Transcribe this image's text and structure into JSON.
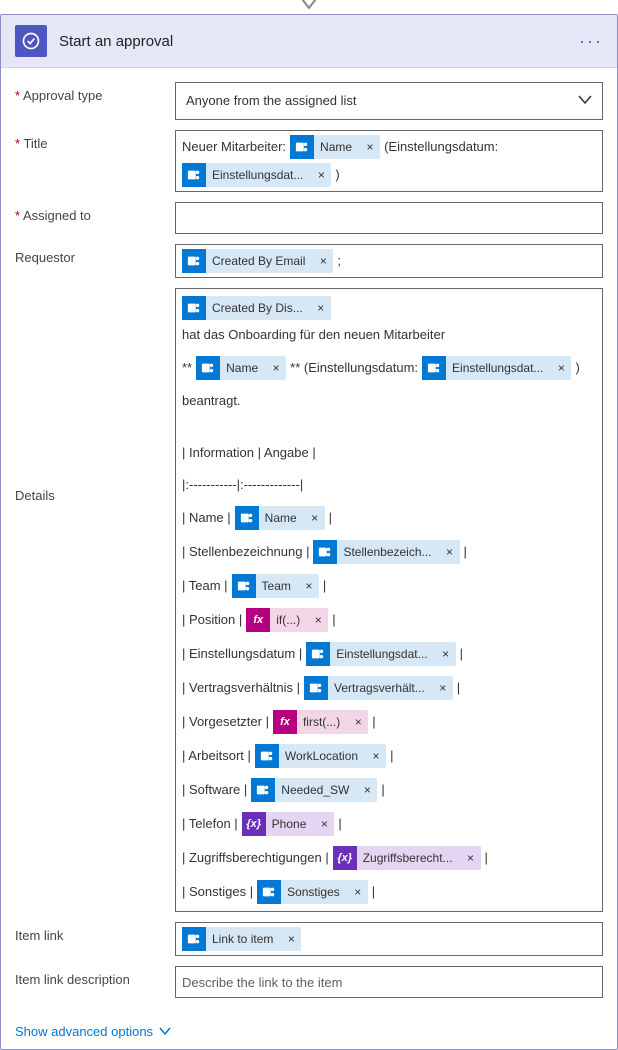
{
  "header": {
    "title": "Start an approval"
  },
  "approval_type": {
    "label": "Approval type",
    "value": "Anyone from the assigned list"
  },
  "title": {
    "label": "Title",
    "text_before": "Neuer Mitarbeiter:",
    "token_name": "Name",
    "text_mid": "(Einstellungsdatum:",
    "token_date": "Einstellungsdat...",
    "text_after": ")"
  },
  "assigned_to": {
    "label": "Assigned to"
  },
  "requestor": {
    "label": "Requestor",
    "token": "Created By Email",
    "after": ";"
  },
  "details": {
    "label": "Details",
    "line1_t1": "Created By Dis...",
    "line1_txt": "hat das Onboarding für den neuen Mitarbeiter",
    "line2_pre": "**",
    "line2_name": "Name",
    "line2_mid": "** (Einstellungsdatum:",
    "line2_date": "Einstellungsdat...",
    "line2_end": ")",
    "line3": "beantragt.",
    "table_header": "| Information | Angabe |",
    "table_sep": "|:-----------|:-------------|",
    "row_name_l": "| Name |",
    "row_name_t": "Name",
    "row_name_e": "|",
    "row_stelle_l": "| Stellenbezeichnung |",
    "row_stelle_t": "Stellenbezeich...",
    "row_stelle_e": "|",
    "row_team_l": "| Team |",
    "row_team_t": "Team",
    "row_team_e": "|",
    "row_pos_l": "| Position |",
    "row_pos_t": "if(...)",
    "row_pos_e": "|",
    "row_einst_l": "| Einstellungsdatum |",
    "row_einst_t": "Einstellungsdat...",
    "row_einst_e": "|",
    "row_vert_l": "| Vertragsverhältnis |",
    "row_vert_t": "Vertragsverhält...",
    "row_vert_e": "|",
    "row_vorg_l": "| Vorgesetzter |",
    "row_vorg_t": "first(...)",
    "row_vorg_e": "|",
    "row_arb_l": "| Arbeitsort |",
    "row_arb_t": "WorkLocation",
    "row_arb_e": "|",
    "row_soft_l": "| Software |",
    "row_soft_t": "Needed_SW",
    "row_soft_e": "|",
    "row_tel_l": "| Telefon |",
    "row_tel_t": "Phone",
    "row_tel_e": "|",
    "row_zug_l": "| Zugriffsberechtigungen |",
    "row_zug_t": "Zugriffsberecht...",
    "row_zug_e": "|",
    "row_son_l": "| Sonstiges |",
    "row_son_t": "Sonstiges",
    "row_son_e": "|"
  },
  "item_link": {
    "label": "Item link",
    "token": "Link to item"
  },
  "item_link_desc": {
    "label": "Item link description",
    "placeholder": "Describe the link to the item"
  },
  "footer": {
    "label": "Show advanced options"
  },
  "fx_label": "fx",
  "var_label": "{x}"
}
